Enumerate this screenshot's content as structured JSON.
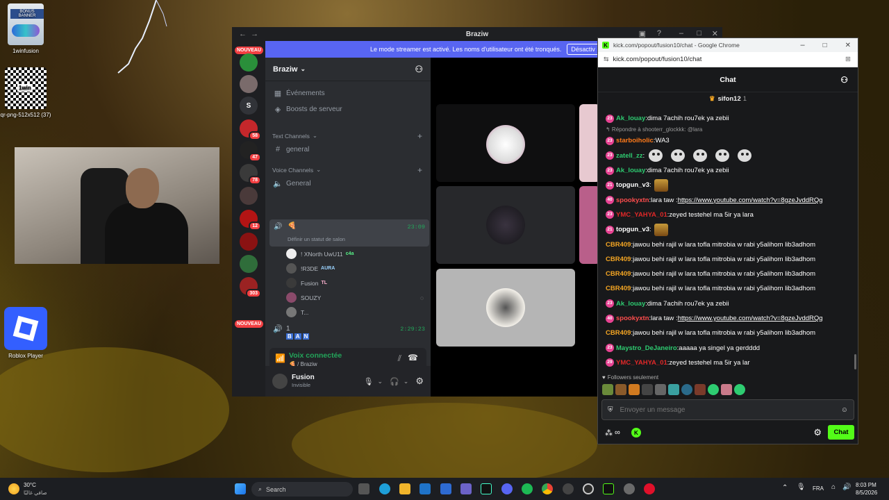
{
  "desktop": {
    "icons": [
      {
        "label": "1winfusion",
        "logo_text": "BONUS BANNER"
      },
      {
        "label": "qr-png-512x512 (37)",
        "logo_text": "1win"
      },
      {
        "label": "Roblox Player"
      }
    ]
  },
  "discord": {
    "window_title": "Braziw",
    "banner_text": "Le mode streamer est activé. Les noms d'utilisateur ont été tronqués.",
    "banner_button": "Désactiv",
    "new_badge": "NOUVEAU",
    "guild_letter": "S",
    "guild_badges": [
      "58",
      "47",
      "78",
      "12",
      "303"
    ],
    "server_name": "Braziw",
    "events_label": "Événements",
    "boosts_label": "Boosts de serveur",
    "text_channels_label": "Text Channels",
    "general_text": "general",
    "voice_channels_label": "Voice Channels",
    "general_voice": "General",
    "active_channel": {
      "name": "🍕",
      "status": "Définir un statut de salon",
      "timer": "23:09"
    },
    "voice_users": [
      {
        "name": "! XNorth UwU11",
        "tag": "c4a"
      },
      {
        "name": "!R3DE",
        "tag": "AURA"
      },
      {
        "name": "Fusion",
        "tag": "TL"
      },
      {
        "name": "SOUZY",
        "tag": ""
      },
      {
        "name": "T...",
        "tag": ""
      }
    ],
    "channel_one": {
      "name": "1",
      "timer": "2:29:23",
      "tags": [
        "B",
        "A",
        "N"
      ]
    },
    "voice_connected": "Voix connectée",
    "voice_location": "🍕 / Braziw",
    "user_name": "Fusion",
    "user_status": "Invisible"
  },
  "kick": {
    "window_title": "kick.com/popout/fusion10/chat - Google Chrome",
    "url": "kick.com/popout/fusion10/chat",
    "header": "Chat",
    "pinned_user": "sifon12",
    "pinned_count": "1",
    "messages": [
      {
        "badge": "23",
        "user": "Ak_louay",
        "color": "#2ecc71",
        "text": "dima 7achih rou7ek ya zebii"
      },
      {
        "reply": "Répondre à shooterr_glockkk: @lara"
      },
      {
        "badge": "23",
        "user": "starboiholic",
        "color": "#ff7a1a",
        "text": "WA3"
      },
      {
        "badge": "23",
        "user": "zatell_zz",
        "color": "#2ecc71",
        "text": "",
        "emotes": 5
      },
      {
        "badge": "23",
        "user": "Ak_louay",
        "color": "#2ecc71",
        "text": "dima 7achih rou7ek ya zebii"
      },
      {
        "badge": "21",
        "user": "topgun_v3",
        "color": "#ffffff",
        "text": "",
        "emote_box": true
      },
      {
        "badge": "40",
        "user": "spookyxtn",
        "color": "#ff4d4d",
        "text": "lara taw : ",
        "link": "https://www.youtube.com/watch?v=8gzeJvddRQg"
      },
      {
        "badge": "23",
        "user": "YMC_YAHYA_01",
        "color": "#e02828",
        "text": "zeyed testehel ma 5ir ya lara"
      },
      {
        "badge": "21",
        "user": "topgun_v3",
        "color": "#ffffff",
        "text": "",
        "emote_box": true
      },
      {
        "user": "CBR409",
        "color": "#f5a623",
        "text": "jawou behi rajil w lara tofla mitrobia w rabi y5alihom lib3adhom"
      },
      {
        "user": "CBR409",
        "color": "#f5a623",
        "text": "jawou behi rajil w lara tofla mitrobia w rabi y5alihom lib3adhom"
      },
      {
        "user": "CBR409",
        "color": "#f5a623",
        "text": "jawou behi rajil w lara tofla mitrobia w rabi y5alihom lib3adhom"
      },
      {
        "user": "CBR409",
        "color": "#f5a623",
        "text": "jawou behi rajil w lara tofla mitrobia w rabi y5alihom lib3adhom"
      },
      {
        "badge": "23",
        "user": "Ak_louay",
        "color": "#2ecc71",
        "text": "dima 7achih rou7ek ya zebii"
      },
      {
        "badge": "40",
        "user": "spookyxtn",
        "color": "#ff4d4d",
        "text": "lara taw : ",
        "link": "https://www.youtube.com/watch?v=8gzeJvddRQg"
      },
      {
        "user": "CBR409",
        "color": "#f5a623",
        "text": "jawou behi rajil w lara tofla mitrobia w rabi y5alihom lib3adhom"
      },
      {
        "badge": "23",
        "user": "Maystro_DeJaneiro",
        "color": "#2ecc71",
        "text": "aaaaa ya singel ya gerdddd"
      },
      {
        "badge": "29",
        "user": "YMC_YAHYA_01",
        "color": "#e02828",
        "text": "zeyed testehel ma 5ir ya lar"
      }
    ],
    "followers_only": "Followers seulement",
    "input_placeholder": "Envoyer un message",
    "chat_button": "Chat"
  },
  "taskbar": {
    "weather_temp": "30°C",
    "weather_desc": "صافي غالبًا",
    "search_label": "Search",
    "lang": "FRA",
    "time": "8:03 PM",
    "date": "8/5/2026"
  }
}
